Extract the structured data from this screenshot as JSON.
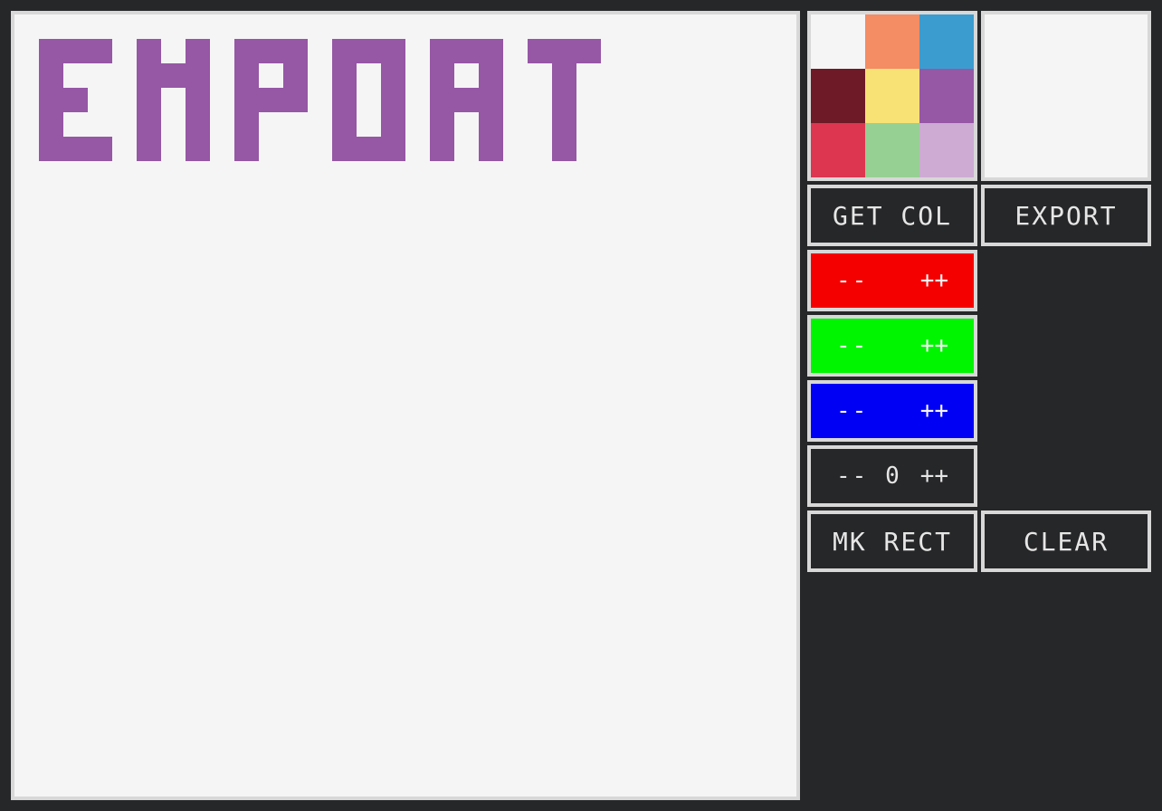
{
  "canvas": {
    "pixel_color": "#9657a5",
    "background": "#f5f5f5"
  },
  "palette": {
    "colors": [
      "#f5f5f5",
      "#f48c64",
      "#3b9ccf",
      "#6e1a27",
      "#f9e275",
      "#9657a5",
      "#dc3651",
      "#97d093",
      "#cdabd3"
    ]
  },
  "preview": {
    "color": "#f5f5f5"
  },
  "buttons": {
    "get_col": "GET COL",
    "export": "EXPORT",
    "mk_rect": "MK RECT",
    "clear": "CLEAR"
  },
  "channels": {
    "red": {
      "dec": "--",
      "inc": "++",
      "color": "#f50000"
    },
    "green": {
      "dec": "--",
      "inc": "++",
      "color": "#00f500"
    },
    "blue": {
      "dec": "--",
      "inc": "++",
      "color": "#0000f5"
    }
  },
  "size_stepper": {
    "dec": "--",
    "value": "0",
    "inc": "++"
  }
}
